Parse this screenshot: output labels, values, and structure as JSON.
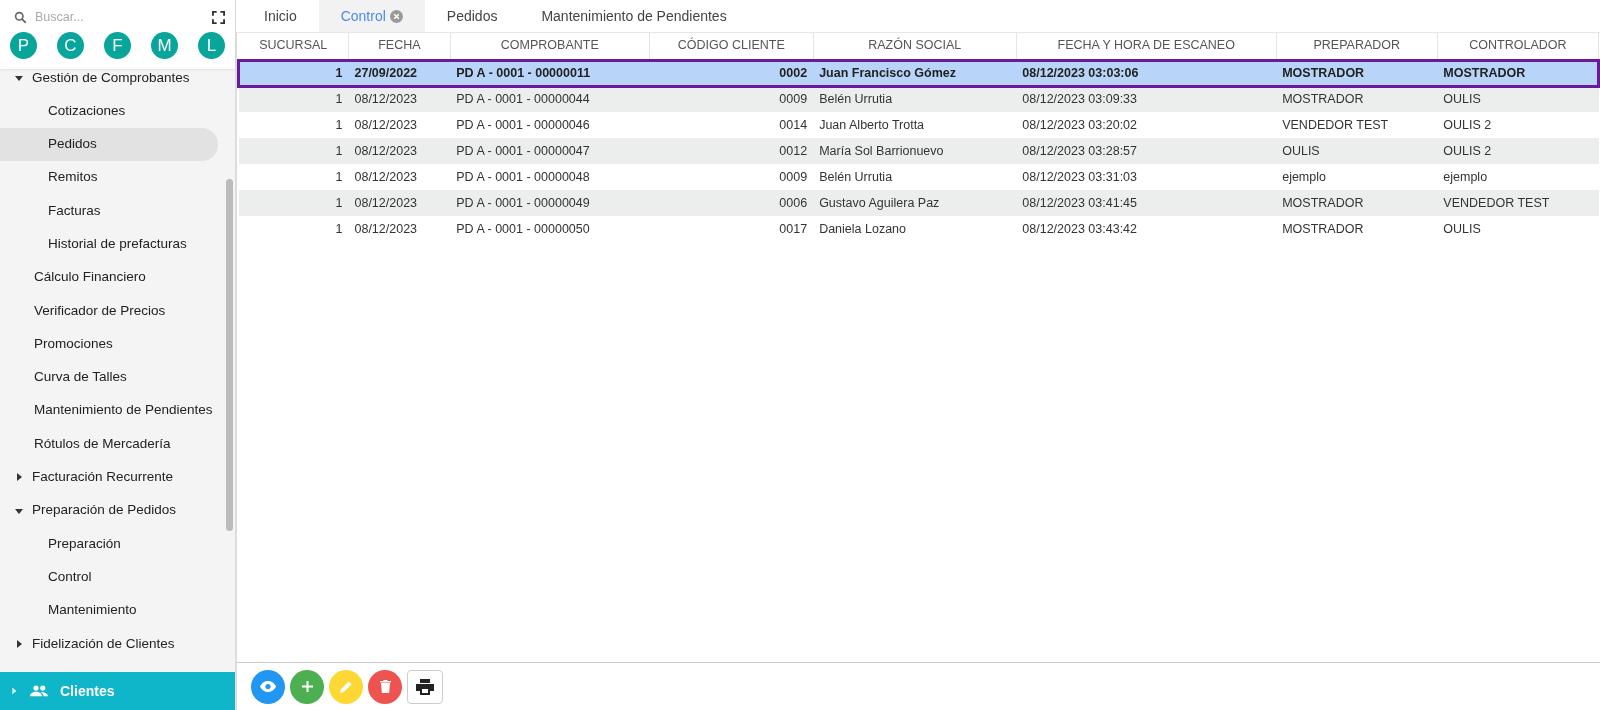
{
  "sidebar": {
    "search": {
      "placeholder": "Buscar..."
    },
    "shortcuts": [
      "P",
      "C",
      "F",
      "M",
      "L"
    ],
    "items": [
      {
        "label": "Gestión de Comprobantes",
        "expanded": true,
        "selected": false,
        "children": [
          {
            "label": "Cotizaciones",
            "selected": false
          },
          {
            "label": "Pedidos",
            "selected": true
          },
          {
            "label": "Remitos",
            "selected": false
          },
          {
            "label": "Facturas",
            "selected": false
          },
          {
            "label": "Historial de prefacturas",
            "selected": false
          }
        ]
      },
      {
        "label": "Cálculo Financiero",
        "selected": false
      },
      {
        "label": "Verificador de Precios",
        "selected": false
      },
      {
        "label": "Promociones",
        "selected": false
      },
      {
        "label": "Curva de Talles",
        "selected": false
      },
      {
        "label": "Mantenimiento de Pendientes",
        "selected": false
      },
      {
        "label": "Rótulos de Mercadería",
        "selected": false
      },
      {
        "label": "Facturación Recurrente",
        "expanded": false,
        "selected": false
      },
      {
        "label": "Preparación de Pedidos",
        "expanded": true,
        "selected": false,
        "children": [
          {
            "label": "Preparación",
            "selected": false
          },
          {
            "label": "Control",
            "selected": false
          },
          {
            "label": "Mantenimiento",
            "selected": false
          }
        ]
      },
      {
        "label": "Fidelización de Clientes",
        "expanded": false,
        "selected": false
      }
    ],
    "footer": {
      "label": "Clientes",
      "expanded": false
    }
  },
  "tabs": [
    {
      "label": "Inicio",
      "selected": false,
      "closable": false
    },
    {
      "label": "Control",
      "selected": true,
      "closable": true
    },
    {
      "label": "Pedidos",
      "selected": false,
      "closable": false
    },
    {
      "label": "Mantenimiento de Pendientes",
      "selected": false,
      "closable": false
    }
  ],
  "table": {
    "columns": [
      {
        "label": "SUCURSAL",
        "kind": "number"
      },
      {
        "label": "FECHA",
        "kind": "text"
      },
      {
        "label": "COMPROBANTE",
        "kind": "text"
      },
      {
        "label": "CÓDIGO CLIENTE",
        "kind": "number"
      },
      {
        "label": "RAZÓN SOCIAL",
        "kind": "text"
      },
      {
        "label": "FECHA Y HORA DE ESCANEO",
        "kind": "text"
      },
      {
        "label": "PREPARADOR",
        "kind": "text"
      },
      {
        "label": "CONTROLADOR",
        "kind": "text"
      }
    ],
    "rows": [
      {
        "selected": true,
        "cells": [
          "1",
          "27/09/2022",
          "PD A - 0001 - 00000011",
          "0002",
          "Juan Francisco Gómez",
          "08/12/2023 03:03:06",
          "MOSTRADOR",
          "MOSTRADOR"
        ]
      },
      {
        "selected": false,
        "cells": [
          "1",
          "08/12/2023",
          "PD A - 0001 - 00000044",
          "0009",
          "Belén Urrutia",
          "08/12/2023 03:09:33",
          "MOSTRADOR",
          "OULIS"
        ]
      },
      {
        "selected": false,
        "cells": [
          "1",
          "08/12/2023",
          "PD A - 0001 - 00000046",
          "0014",
          "Juan Alberto Trotta",
          "08/12/2023 03:20:02",
          "VENDEDOR TEST",
          "OULIS 2"
        ]
      },
      {
        "selected": false,
        "cells": [
          "1",
          "08/12/2023",
          "PD A - 0001 - 00000047",
          "0012",
          "María Sol Barrionuevo",
          "08/12/2023 03:28:57",
          "OULIS",
          "OULIS 2"
        ]
      },
      {
        "selected": false,
        "cells": [
          "1",
          "08/12/2023",
          "PD A - 0001 - 00000048",
          "0009",
          "Belén Urrutia",
          "08/12/2023 03:31:03",
          "ejemplo",
          "ejemplo"
        ]
      },
      {
        "selected": false,
        "cells": [
          "1",
          "08/12/2023",
          "PD A - 0001 - 00000049",
          "0006",
          "Gustavo Aguilera Paz",
          "08/12/2023 03:41:45",
          "MOSTRADOR",
          "VENDEDOR TEST"
        ]
      },
      {
        "selected": false,
        "cells": [
          "1",
          "08/12/2023",
          "PD A - 0001 - 00000050",
          "0017",
          "Daniela Lozano",
          "08/12/2023 03:43:42",
          "MOSTRADOR",
          "OULIS"
        ]
      }
    ]
  },
  "toolbar": [
    {
      "kind": "view"
    },
    {
      "kind": "add"
    },
    {
      "kind": "edit"
    },
    {
      "kind": "delete"
    },
    {
      "kind": "print"
    }
  ]
}
